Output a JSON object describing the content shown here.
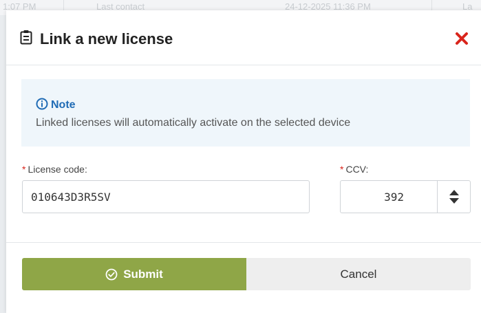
{
  "background": {
    "items": [
      "1:07 PM",
      "Last contact",
      "24-12-2025 11:36 PM",
      "La"
    ]
  },
  "dialog": {
    "title": "Link a new license",
    "header_icon": "clipboard-icon",
    "close_icon": "close-icon",
    "close_color": "#d9251c"
  },
  "note": {
    "title": "Note",
    "icon": "info-icon",
    "text": "Linked licenses will automatically activate on the selected device",
    "title_color": "#1f6bb5",
    "background": "#eff6fb"
  },
  "form": {
    "required_mark": "*",
    "license_label": "License code:",
    "license_value": "010643D3R5SV",
    "ccv_label": "CCV:",
    "ccv_value": "392",
    "ccv_stepper_icon": "up-down-caret-icon"
  },
  "actions": {
    "submit_label": "Submit",
    "submit_icon": "check-circle-icon",
    "cancel_label": "Cancel",
    "submit_color": "#8fa647"
  }
}
